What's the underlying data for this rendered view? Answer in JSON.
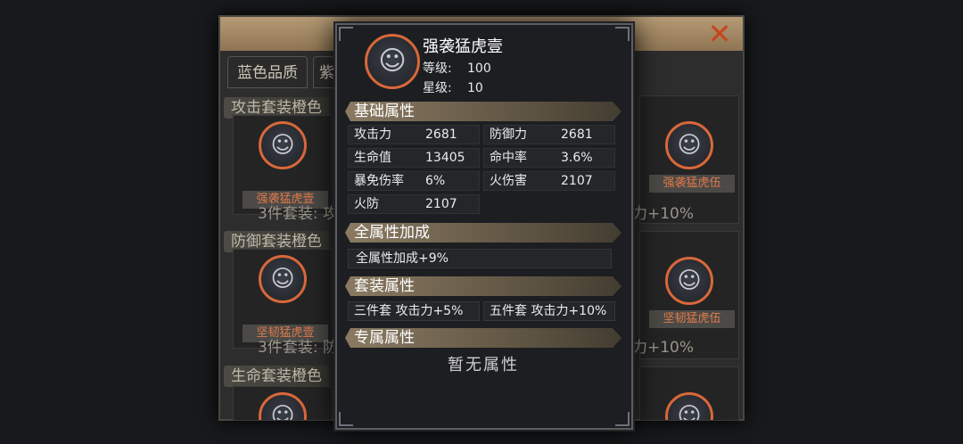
{
  "background": {
    "tabs": [
      "蓝色品质",
      "紫"
    ],
    "close_icon": "close-icon",
    "col_labels": [
      "攻击套装橙色",
      "防御套装橙色",
      "生命套装橙色"
    ],
    "left_cards": [
      "强袭猛虎壹",
      "坚韧猛虎壹"
    ],
    "right_cards": [
      "强袭猛虎伍",
      "坚韧猛虎伍"
    ],
    "left_set_lines": [
      "3件套装: 攻",
      "3件套装: 防"
    ],
    "right_set_lines": [
      "力+10%",
      "力+10%"
    ]
  },
  "detail": {
    "name": "强袭猛虎壹",
    "level_label": "等级:",
    "level_value": "100",
    "star_label": "星级:",
    "star_value": "10",
    "base_section": "基础属性",
    "base_stats": [
      {
        "k": "攻击力",
        "v": "2681"
      },
      {
        "k": "防御力",
        "v": "2681"
      },
      {
        "k": "生命值",
        "v": "13405"
      },
      {
        "k": "命中率",
        "v": "3.6%"
      },
      {
        "k": "暴免伤率",
        "v": "6%"
      },
      {
        "k": "火伤害",
        "v": "2107"
      },
      {
        "k": "火防",
        "v": "2107"
      }
    ],
    "all_bonus_section": "全属性加成",
    "all_bonus_value": "全属性加成+9%",
    "set_section": "套装属性",
    "set_bonus": [
      "三件套 攻击力+5%",
      "五件套 攻击力+10%"
    ],
    "exclusive_section": "专属属性",
    "exclusive_value": "暂无属性"
  },
  "colors": {
    "accent_orange": "#d9683a",
    "section_bar": "#8a7a62",
    "panel_bg": "#1c1e22"
  }
}
